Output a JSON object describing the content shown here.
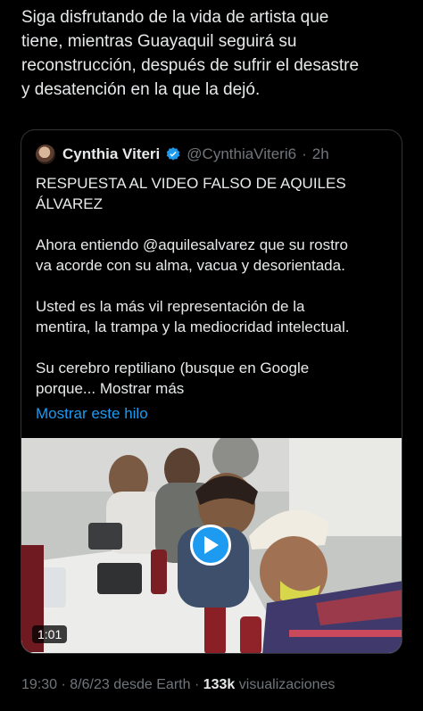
{
  "tweet": {
    "text": "Siga disfrutando de la vida de artista que\ntiene, mientras Guayaquil seguirá su\nreconstrucción, después de sufrir el desastre\ny desatención en la que la dejó."
  },
  "quote": {
    "author_name": "Cynthia Viteri",
    "handle": "@CynthiaViteri6",
    "separator": "·",
    "time": "2h",
    "body": "RESPUESTA AL VIDEO FALSO DE AQUILES\nÁLVAREZ\n\nAhora entiendo @aquilesalvarez que su rostro\nva acorde con su alma, vacua y desorientada.\n\nUsted es  la más vil representación de la\nmentira, la trampa y la mediocridad intelectual.\n\nSu cerebro reptiliano (busque en Google\nporque... Mostrar más",
    "show_thread": "Mostrar este hilo",
    "video": {
      "duration": "1:01",
      "play_icon": "play-icon"
    }
  },
  "meta": {
    "time": "19:30",
    "dot1": "·",
    "date": "8/6/23",
    "source": "desde Earth",
    "dot2": "·",
    "views_count": "133k",
    "views_label": "visualizaciones"
  },
  "colors": {
    "background": "#000000",
    "text": "#e7e9ea",
    "secondary": "#71767b",
    "link": "#1d9bf0",
    "border": "#2f3336"
  }
}
